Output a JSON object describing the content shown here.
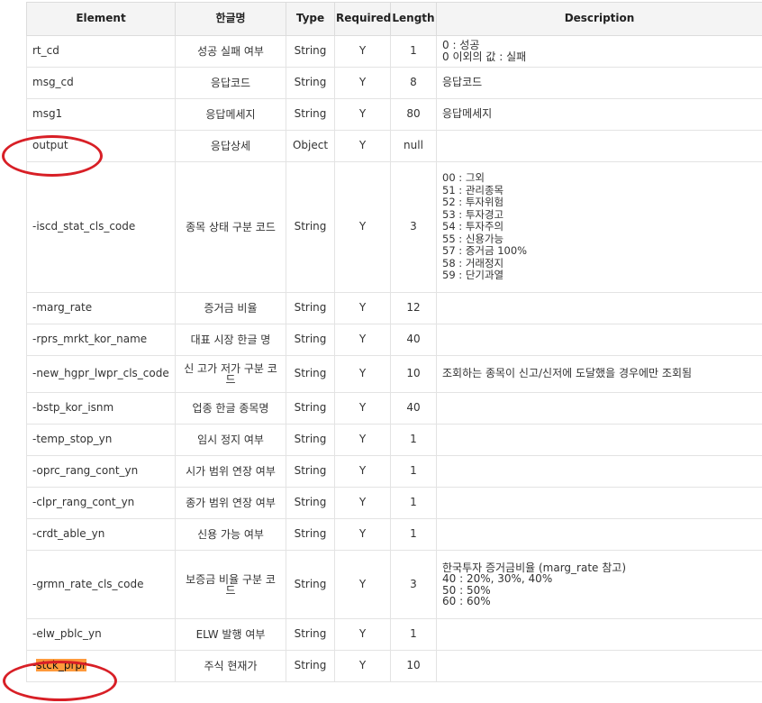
{
  "headers": [
    "Element",
    "한글명",
    "Type",
    "Required",
    "Length",
    "Description"
  ],
  "rows": [
    {
      "element": "rt_cd",
      "kor": "성공 실패 여부",
      "type": "String",
      "required": "Y",
      "length": "1",
      "desc": "0 : 성공\n0 이외의 값 : 실패"
    },
    {
      "element": "msg_cd",
      "kor": "응답코드",
      "type": "String",
      "required": "Y",
      "length": "8",
      "desc": "응답코드"
    },
    {
      "element": "msg1",
      "kor": "응답메세지",
      "type": "String",
      "required": "Y",
      "length": "80",
      "desc": "응답메세지"
    },
    {
      "element": "output",
      "kor": "응답상세",
      "type": "Object",
      "required": "Y",
      "length": "null",
      "desc": ""
    },
    {
      "element": "-iscd_stat_cls_code",
      "kor": "종목 상태 구분 코드",
      "type": "String",
      "required": "Y",
      "length": "3",
      "desc": "00 : 그외\n51 : 관리종목\n52 : 투자위험\n53 : 투자경고\n54 : 투자주의\n55 : 신용가능\n57 : 증거금 100%\n58 : 거래정지\n59 : 단기과열"
    },
    {
      "element": "-marg_rate",
      "kor": "증거금 비율",
      "type": "String",
      "required": "Y",
      "length": "12",
      "desc": ""
    },
    {
      "element": "-rprs_mrkt_kor_name",
      "kor": "대표 시장 한글 명",
      "type": "String",
      "required": "Y",
      "length": "40",
      "desc": ""
    },
    {
      "element": "-new_hgpr_lwpr_cls_code",
      "kor": "신 고가 저가 구분 코드",
      "type": "String",
      "required": "Y",
      "length": "10",
      "desc": "조회하는 종목이 신고/신저에 도달했을 경우에만 조회됨"
    },
    {
      "element": "-bstp_kor_isnm",
      "kor": "업종 한글 종목명",
      "type": "String",
      "required": "Y",
      "length": "40",
      "desc": ""
    },
    {
      "element": "-temp_stop_yn",
      "kor": "임시 정지 여부",
      "type": "String",
      "required": "Y",
      "length": "1",
      "desc": ""
    },
    {
      "element": "-oprc_rang_cont_yn",
      "kor": "시가 범위 연장 여부",
      "type": "String",
      "required": "Y",
      "length": "1",
      "desc": ""
    },
    {
      "element": "-clpr_rang_cont_yn",
      "kor": "종가 범위 연장 여부",
      "type": "String",
      "required": "Y",
      "length": "1",
      "desc": ""
    },
    {
      "element": "-crdt_able_yn",
      "kor": "신용 가능 여부",
      "type": "String",
      "required": "Y",
      "length": "1",
      "desc": ""
    },
    {
      "element": "-grmn_rate_cls_code",
      "kor": "보증금 비율 구분 코드",
      "type": "String",
      "required": "Y",
      "length": "3",
      "desc": "한국투자 증거금비율 (marg_rate 참고)\n40 : 20%, 30%, 40%\n50 : 50%\n60 : 60%"
    },
    {
      "element": "-elw_pblc_yn",
      "kor": "ELW 발행 여부",
      "type": "String",
      "required": "Y",
      "length": "1",
      "desc": ""
    },
    {
      "element": "-stck_prpr",
      "kor": "주식 현재가",
      "type": "String",
      "required": "Y",
      "length": "10",
      "desc": ""
    }
  ],
  "annotations": {
    "circled_elements": [
      "output",
      "-stck_prpr"
    ],
    "highlighted_text": "stck_prpr",
    "highlight_color": "#ff9a3c",
    "circle_color": "#d81f26"
  }
}
